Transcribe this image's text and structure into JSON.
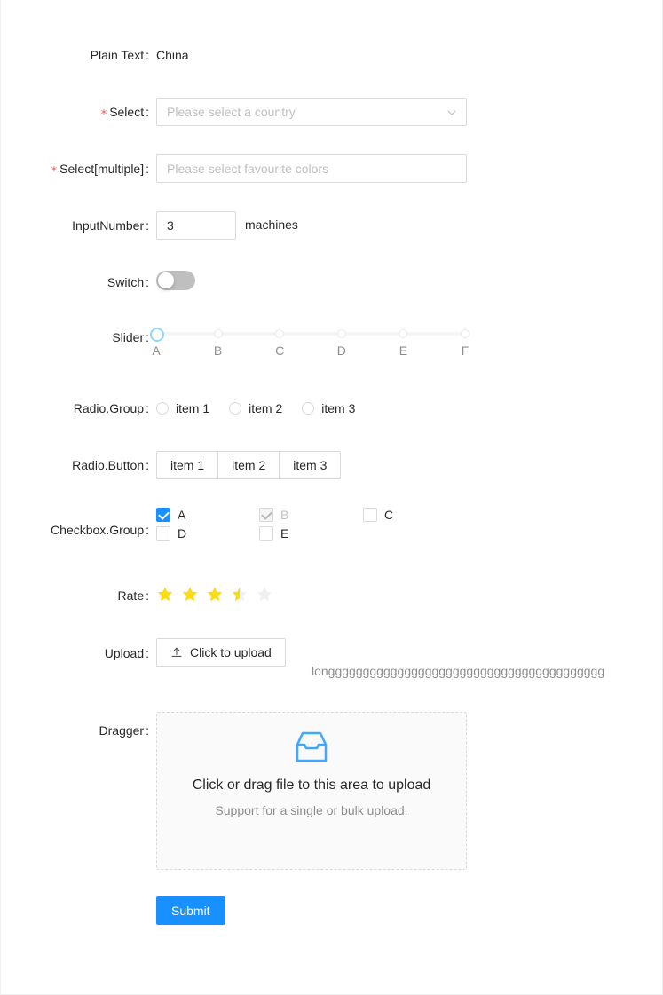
{
  "theme": {
    "primary": "#1890ff",
    "required_asterisk": "#ff4d4f",
    "border": "#d9d9d9",
    "placeholder": "#bfbfbf",
    "star_active": "#fadb14",
    "star_inactive": "#f0f0f0",
    "switch_off": "#bfbfbf",
    "slider_handle_ring": "#91d5ff"
  },
  "form": {
    "plain_text": {
      "label": "Plain Text",
      "value": "China",
      "required": false
    },
    "select": {
      "label": "Select",
      "required": true,
      "placeholder": "Please select a country",
      "value": "",
      "icon": "chevron-down-icon"
    },
    "select_multiple": {
      "label": "Select[multiple]",
      "required": true,
      "placeholder": "Please select favourite colors",
      "value": ""
    },
    "input_number": {
      "label": "InputNumber",
      "required": false,
      "value": "3",
      "suffix": "machines"
    },
    "switch": {
      "label": "Switch",
      "required": false,
      "checked": false
    },
    "slider": {
      "label": "Slider",
      "required": false,
      "value": 0,
      "marks": [
        "A",
        "B",
        "C",
        "D",
        "E",
        "F"
      ]
    },
    "radio_group": {
      "label": "Radio.Group",
      "required": false,
      "selected": null,
      "options": [
        "item 1",
        "item 2",
        "item 3"
      ]
    },
    "radio_button": {
      "label": "Radio.Button",
      "required": false,
      "selected": null,
      "options": [
        "item 1",
        "item 2",
        "item 3"
      ]
    },
    "checkbox_group": {
      "label": "Checkbox.Group",
      "required": false,
      "options": [
        {
          "label": "A",
          "checked": true,
          "disabled": false
        },
        {
          "label": "B",
          "checked": true,
          "disabled": true
        },
        {
          "label": "C",
          "checked": false,
          "disabled": false
        },
        {
          "label": "D",
          "checked": false,
          "disabled": false
        },
        {
          "label": "E",
          "checked": false,
          "disabled": false
        }
      ]
    },
    "rate": {
      "label": "Rate",
      "required": false,
      "value": 3.5,
      "count": 5
    },
    "upload": {
      "label": "Upload",
      "required": false,
      "button_label": "Click to upload",
      "button_icon": "upload-icon",
      "file_name": "longggggggggggggggggggggggggggggggggggggggg"
    },
    "dragger": {
      "label": "Dragger",
      "required": false,
      "icon": "inbox-icon",
      "title": "Click or drag file to this area to upload",
      "hint": "Support for a single or bulk upload."
    },
    "submit": {
      "label": "Submit"
    }
  }
}
